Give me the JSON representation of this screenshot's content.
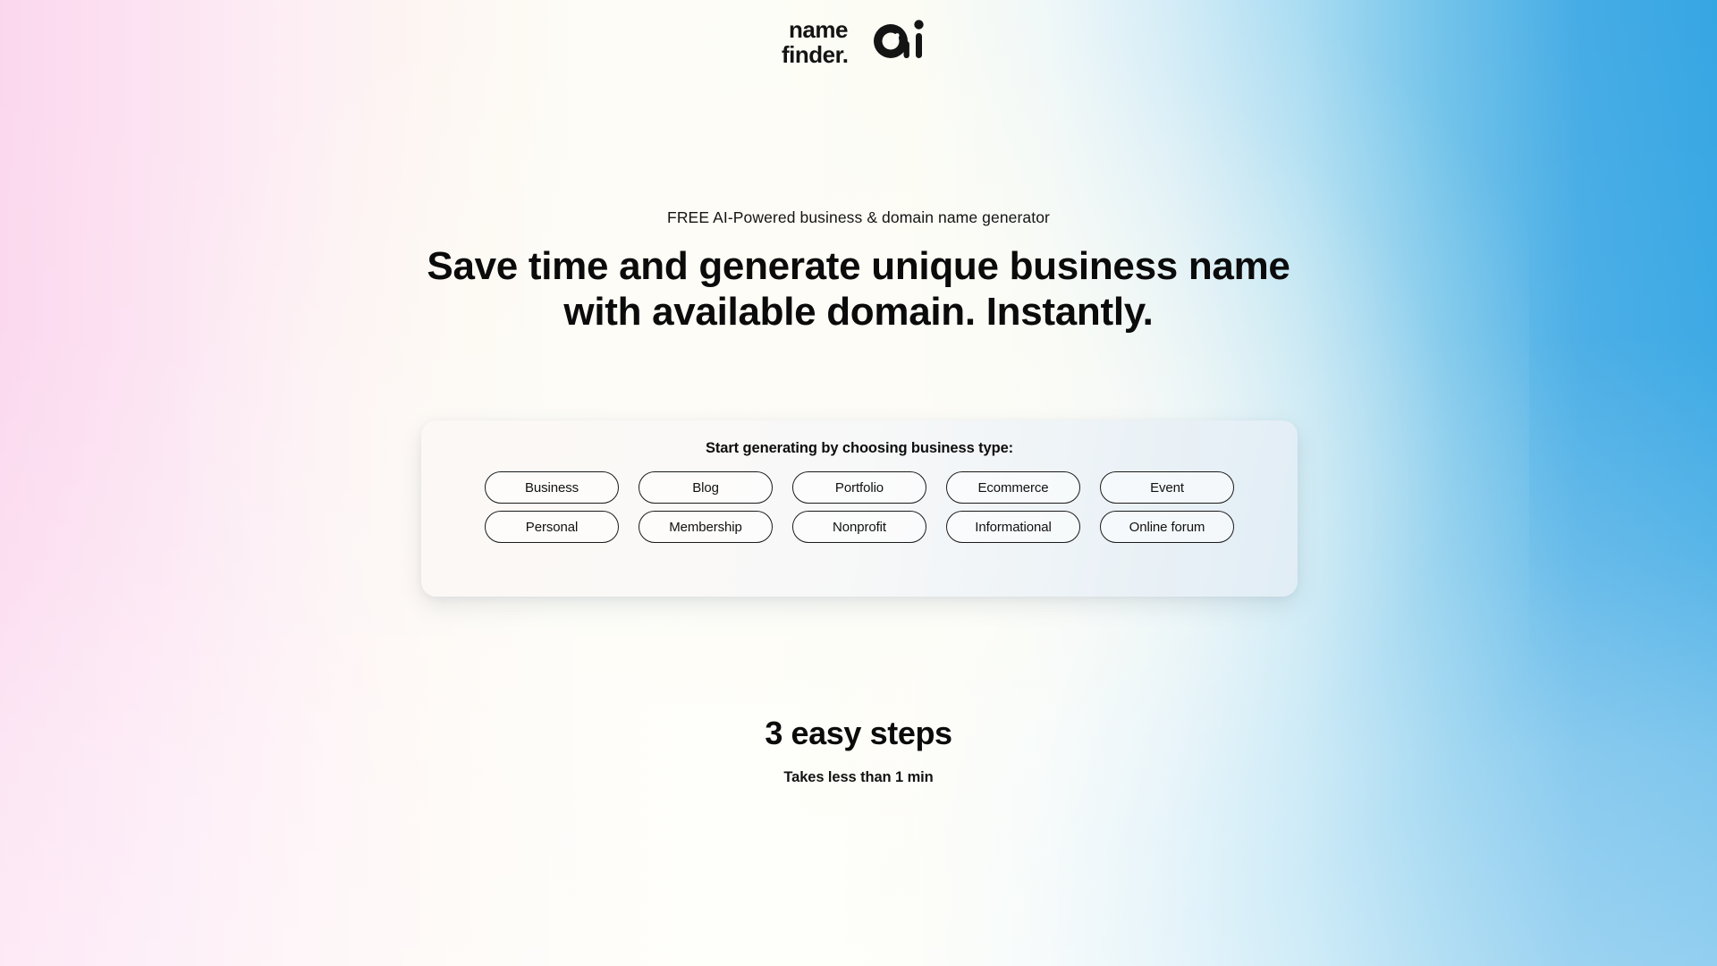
{
  "brand": {
    "logo_icon": "namefinder-ai-logo",
    "name_line1": "name",
    "name_line2": "finder.",
    "mark": "ai"
  },
  "hero": {
    "eyebrow": "FREE AI-Powered business & domain name generator",
    "title_line1": "Save time and generate unique business name",
    "title_line2": "with available domain. Instantly."
  },
  "selector_card": {
    "title": "Start generating by choosing business type:",
    "rows": [
      [
        {
          "label": "Business"
        },
        {
          "label": "Blog"
        },
        {
          "label": "Portfolio"
        },
        {
          "label": "Ecommerce"
        },
        {
          "label": "Event"
        }
      ],
      [
        {
          "label": "Personal"
        },
        {
          "label": "Membership"
        },
        {
          "label": "Nonprofit"
        },
        {
          "label": "Informational"
        },
        {
          "label": "Online forum"
        }
      ]
    ]
  },
  "steps": {
    "title": "3 easy steps",
    "subtitle": "Takes less than 1 min"
  },
  "colors": {
    "gradient_left": "#fbd7ee",
    "gradient_center": "#fdfcf6",
    "gradient_right": "#36a6e3",
    "text": "#111111",
    "button_border": "#1a1a1a",
    "card_left": "#fbf8f5",
    "card_right": "#e1edf5"
  }
}
